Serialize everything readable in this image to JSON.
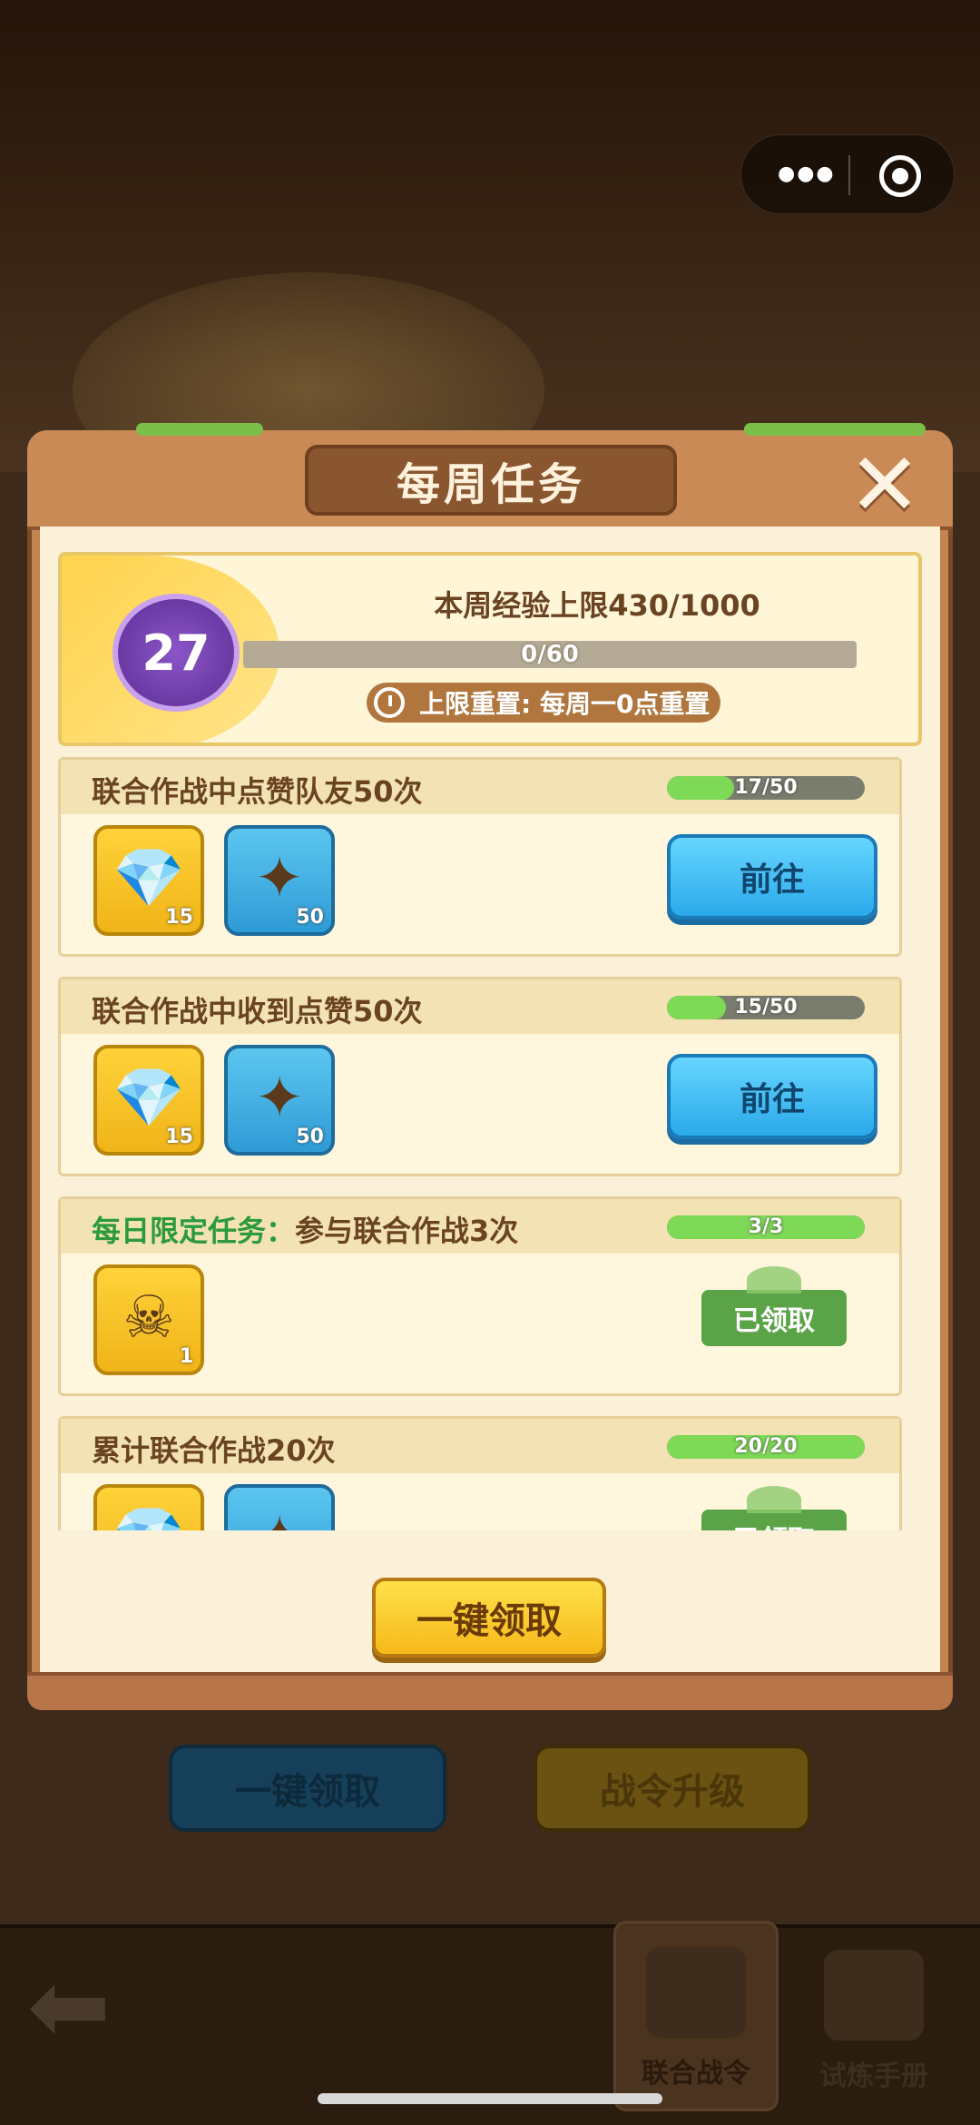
{
  "colors": {
    "accent_green": "#2c9a3c",
    "button_blue": "#2aa9ea",
    "button_yellow": "#f6b91a",
    "frame_brown": "#c48450"
  },
  "topbar": {
    "menu_icon": "more-dots-icon",
    "close_icon": "target-icon"
  },
  "background": {
    "claim_all_label": "一键领取",
    "upgrade_label": "战令升级",
    "nav_tabs": [
      {
        "label": "联合战令",
        "icon": "gun-icon"
      },
      {
        "label": "试炼手册",
        "icon": "scroll-icon"
      }
    ]
  },
  "modal": {
    "title": "每周任务",
    "exp": {
      "level": "27",
      "title": "本周经验上限430/1000",
      "progress_text": "0/60",
      "progress_ratio": 0,
      "reset_text": "上限重置: 每周一0点重置"
    },
    "tasks": [
      {
        "prefix": "",
        "name": "联合作战中点赞队友50次",
        "progress_text": "17/50",
        "progress_ratio": 0.34,
        "rewards": [
          {
            "icon": "diamond-icon",
            "qty": "15"
          },
          {
            "icon": "silver-emblem-icon",
            "qty": "50"
          }
        ],
        "action": "前往",
        "state": "go"
      },
      {
        "prefix": "",
        "name": "联合作战中收到点赞50次",
        "progress_text": "15/50",
        "progress_ratio": 0.3,
        "rewards": [
          {
            "icon": "diamond-icon",
            "qty": "15"
          },
          {
            "icon": "silver-emblem-icon",
            "qty": "50"
          }
        ],
        "action": "前往",
        "state": "go"
      },
      {
        "prefix": "每日限定任务：",
        "name": "参与联合作战3次",
        "progress_text": "3/3",
        "progress_ratio": 1,
        "rewards": [
          {
            "icon": "skull-scroll-icon",
            "qty": "1"
          }
        ],
        "action": "已领取",
        "state": "claimed"
      },
      {
        "prefix": "",
        "name": "累计联合作战20次",
        "progress_text": "20/20",
        "progress_ratio": 1,
        "rewards": [
          {
            "icon": "diamond-icon",
            "qty": ""
          },
          {
            "icon": "silver-emblem-icon",
            "qty": ""
          }
        ],
        "action": "已领取",
        "state": "claimed"
      }
    ],
    "claim_all_label": "一键领取"
  }
}
